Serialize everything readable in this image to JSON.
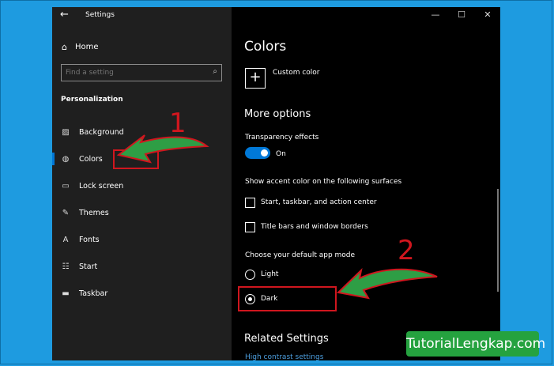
{
  "titlebar": {
    "title": "Settings",
    "back_glyph": "←",
    "min_glyph": "—",
    "max_glyph": "☐",
    "close_glyph": "✕"
  },
  "sidebar": {
    "home": "Home",
    "search_placeholder": "Find a setting",
    "section": "Personalization",
    "items": [
      {
        "label": "Background",
        "icon": "picture-icon"
      },
      {
        "label": "Colors",
        "icon": "palette-icon"
      },
      {
        "label": "Lock screen",
        "icon": "lock-screen-icon"
      },
      {
        "label": "Themes",
        "icon": "themes-icon"
      },
      {
        "label": "Fonts",
        "icon": "fonts-icon"
      },
      {
        "label": "Start",
        "icon": "start-icon"
      },
      {
        "label": "Taskbar",
        "icon": "taskbar-icon"
      }
    ]
  },
  "main": {
    "title": "Colors",
    "custom_color": "Custom color",
    "more_options": "More options",
    "transparency_label": "Transparency effects",
    "transparency_state": "On",
    "accent_label": "Show accent color on the following surfaces",
    "accent_options": [
      "Start, taskbar, and action center",
      "Title bars and window borders"
    ],
    "app_mode_label": "Choose your default app mode",
    "app_modes": [
      "Light",
      "Dark"
    ],
    "app_mode_selected": "Dark",
    "related_title": "Related Settings",
    "related_link": "High contrast settings"
  },
  "annotations": {
    "step1": "1",
    "step2": "2",
    "watermark": "TutorialLengkap.com"
  },
  "colors": {
    "accent": "#0078d7",
    "highlight_red": "#d0161e",
    "arrow_green": "#2e9e45",
    "background": "#1e9be0"
  }
}
